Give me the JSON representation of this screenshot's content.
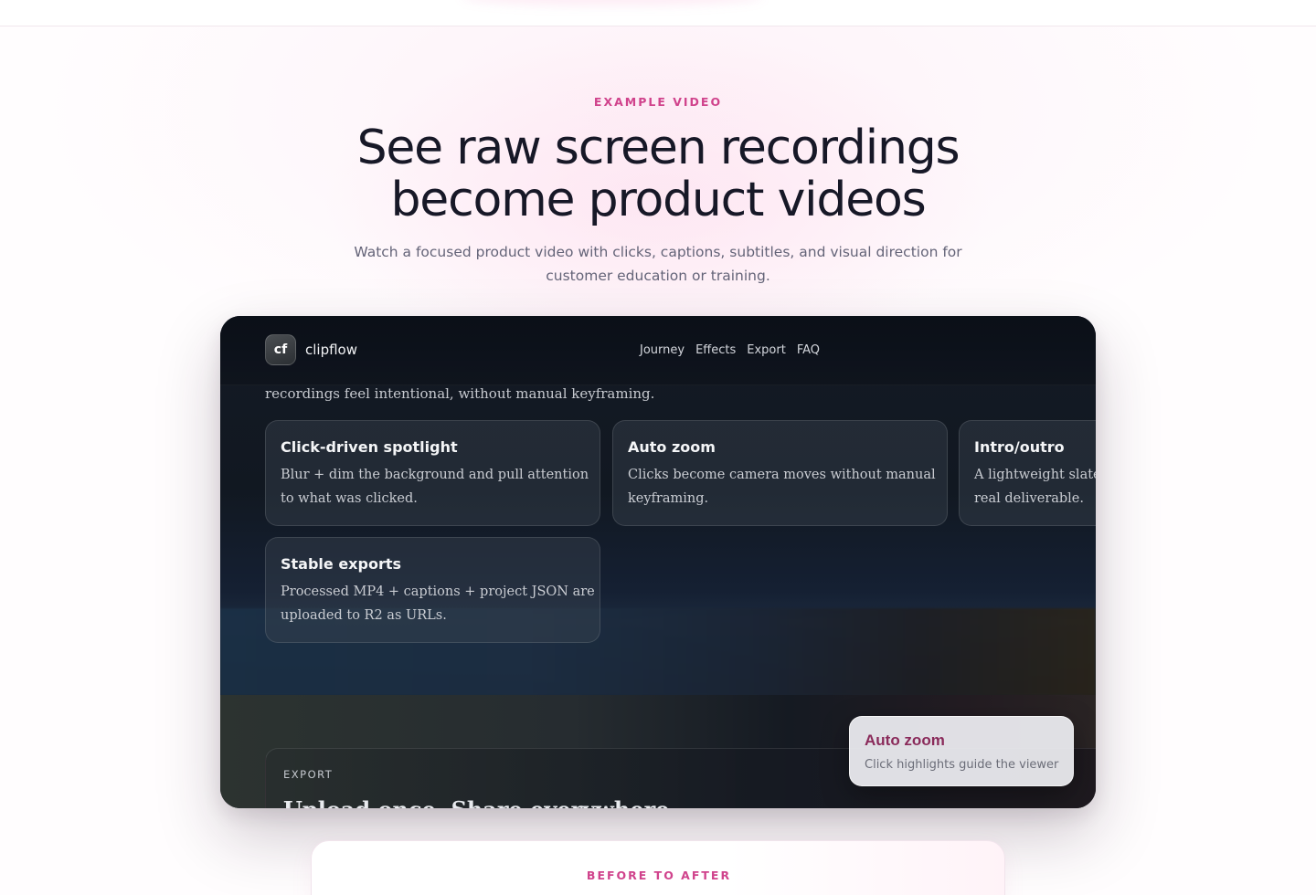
{
  "section": {
    "eyebrow": "EXAMPLE VIDEO",
    "headline_line1": "See raw screen recordings",
    "headline_line2": "become product videos",
    "subtitle_line1": "Watch a focused product video with clicks, captions, subtitles, and visual direction for",
    "subtitle_line2": "customer education or training."
  },
  "video": {
    "app": {
      "logo_mark": "cf",
      "logo_name": "clipflow",
      "nav": [
        "Journey",
        "Effects",
        "Export",
        "FAQ"
      ]
    },
    "intro_text": "recordings feel intentional, without manual keyframing.",
    "cards": [
      {
        "title": "Click-driven spotlight",
        "desc_line1": "Blur + dim the background and pull attention",
        "desc_line2": "to what was clicked."
      },
      {
        "title": "Auto zoom",
        "desc_line1": "Clicks become camera moves without manual",
        "desc_line2": "keyframing."
      },
      {
        "title": "Intro/outro",
        "desc_line1": "A lightweight slate",
        "desc_line2": "real deliverable."
      },
      {
        "title": "Stable exports",
        "desc_line1": "Processed MP4 + captions + project JSON are",
        "desc_line2": "uploaded to R2 as URLs."
      }
    ],
    "export_panel": {
      "label": "EXPORT",
      "heading": "Upload once. Share everywhere."
    },
    "toast": {
      "title": "Auto zoom",
      "desc": "Click highlights guide the viewer"
    }
  },
  "next_section": {
    "eyebrow": "BEFORE TO AFTER"
  },
  "colors": {
    "accent_pink": "#d0438c",
    "headline": "#171827",
    "video_bg": "#0f141d",
    "toast_title": "#8a2a5a"
  }
}
